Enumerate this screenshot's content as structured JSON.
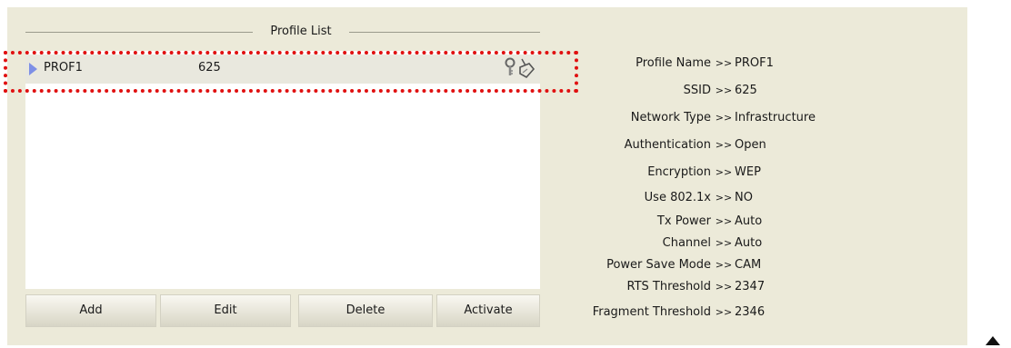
{
  "profile_list": {
    "title": "Profile List",
    "rows": [
      {
        "name": "PROF1",
        "ssid": "625",
        "icons": [
          "key-icon",
          "antenna-icon"
        ]
      }
    ]
  },
  "buttons": {
    "add": "Add",
    "edit": "Edit",
    "delete": "Delete",
    "activate": "Activate"
  },
  "details": {
    "separator": ">>",
    "fields": [
      {
        "label": "Profile Name",
        "value": "PROF1"
      },
      {
        "label": "SSID",
        "value": "625"
      },
      {
        "label": "Network Type",
        "value": "Infrastructure"
      },
      {
        "label": "Authentication",
        "value": "Open"
      },
      {
        "label": "Encryption",
        "value": "WEP"
      },
      {
        "label": "Use 802.1x",
        "value": "NO"
      },
      {
        "label": "Tx Power",
        "value": "Auto"
      },
      {
        "label": "Channel",
        "value": "Auto"
      },
      {
        "label": "Power Save Mode",
        "value": "CAM"
      },
      {
        "label": "RTS Threshold",
        "value": "2347"
      },
      {
        "label": "Fragment Threshold",
        "value": "2346"
      }
    ]
  },
  "colors": {
    "panel_bg": "#ecead9",
    "selected_row_bg": "#e9e8de",
    "highlight": "#e01010",
    "arrow": "#7d8fe6"
  }
}
